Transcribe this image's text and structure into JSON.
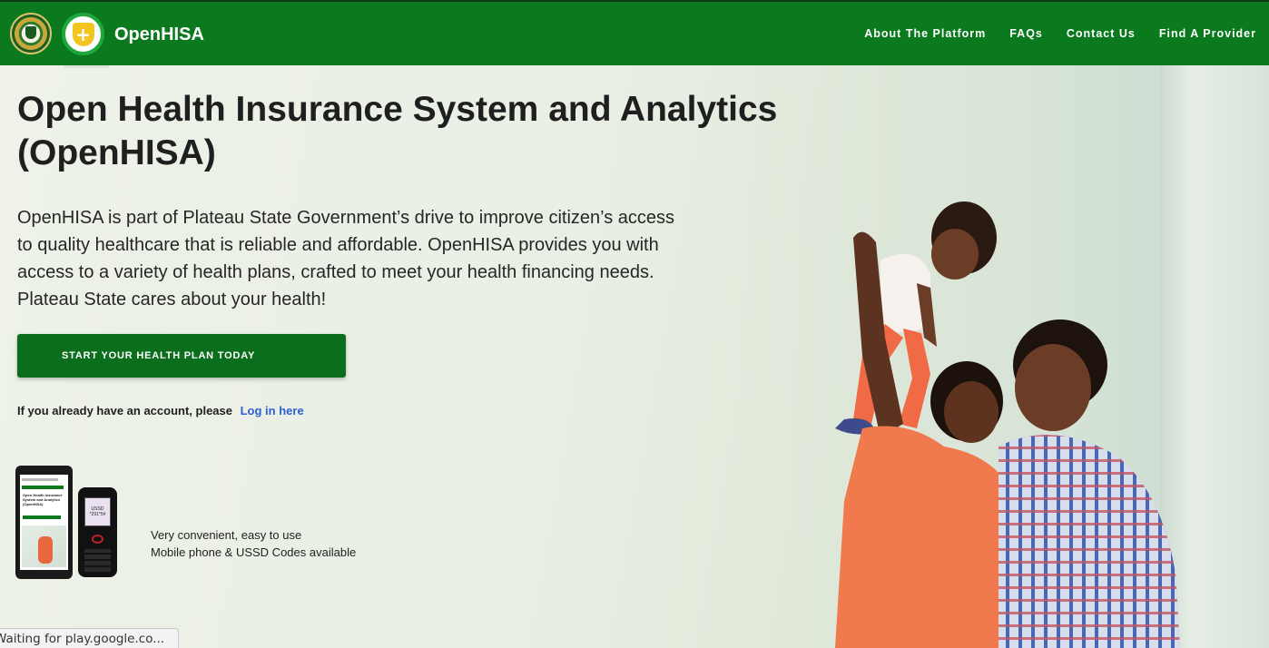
{
  "brand": {
    "name": "OpenHISA"
  },
  "nav": {
    "links": [
      "About The Platform",
      "FAQs",
      "Contact Us",
      "Find A Provider"
    ]
  },
  "hero": {
    "title": "Open Health Insurance System and Analytics (OpenHISA)",
    "description": "OpenHISA is part of Plateau State Government’s drive to improve citizen’s access to quality healthcare that is reliable and affordable. OpenHISA provides you with access to a variety of health plans, crafted to meet your health financing needs. Plateau State cares about your health!",
    "cta_label": "START YOUR HEALTH PLAN TODAY",
    "login_prompt": "If you already have an account, please",
    "login_link": "Log in here"
  },
  "mobile": {
    "line1": "Very convenient, easy to use",
    "line2": "Mobile phone & USSD Codes available",
    "ussd_label": "USSD\n*291*5#"
  },
  "status_bar": {
    "text": "Waiting for play.google.co..."
  },
  "colors": {
    "nav_green": "#0b7a1f",
    "cta_green": "#0b6e1c",
    "link_blue": "#2f5fd0"
  }
}
